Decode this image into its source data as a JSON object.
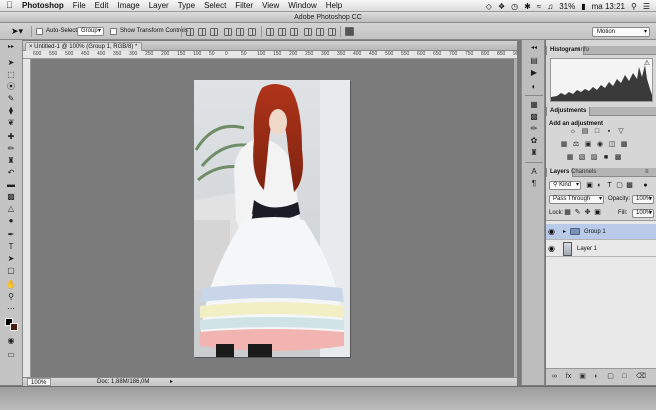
{
  "menubar": {
    "apple_icon": "apple-icon",
    "app_name": "Photoshop",
    "menus": [
      "File",
      "Edit",
      "Image",
      "Layer",
      "Type",
      "Select",
      "Filter",
      "View",
      "Window",
      "Help"
    ],
    "battery": "31%",
    "clock": "ma 13:21"
  },
  "window": {
    "title": "Adobe Photoshop CC"
  },
  "options_bar": {
    "auto_select_label": "Auto-Select:",
    "auto_select_value": "Group",
    "show_transform_label": "Show Transform Controls",
    "workspace": "Motion"
  },
  "document": {
    "tab_title": "Untitled-1 @ 100% (Group 1, RGB/8) *",
    "zoom": "100%",
    "doc_size": "Doc: 1,88M/186,0M",
    "ruler_top_ticks": [
      "600",
      "550",
      "500",
      "450",
      "400",
      "350",
      "300",
      "250",
      "200",
      "150",
      "100",
      "50",
      "0",
      "50",
      "100",
      "150",
      "200",
      "250",
      "300",
      "350",
      "400",
      "450",
      "500",
      "550",
      "600",
      "650",
      "700",
      "750",
      "800",
      "850",
      "900"
    ]
  },
  "panels": {
    "histogram_tab": "Histogram",
    "info_tab": "Info",
    "adjustments_tab": "Adjustments",
    "adjustments_title": "Add an adjustment",
    "layers_tab": "Layers",
    "channels_tab": "Channels",
    "kind_label": "Kind",
    "blend_mode": "Pass Through",
    "opacity_label": "Opacity:",
    "opacity_value": "100%",
    "lock_label": "Lock:",
    "fill_label": "Fill:",
    "fill_value": "100%",
    "layers": [
      {
        "name": "Group 1",
        "type": "group",
        "selected": true
      },
      {
        "name": "Layer 1",
        "type": "layer",
        "selected": false
      }
    ]
  },
  "colors": {
    "selected_layer": "#b9cbe8",
    "canvas_bg": "#7b7b7b",
    "panel_bg": "#d6d6d6"
  }
}
